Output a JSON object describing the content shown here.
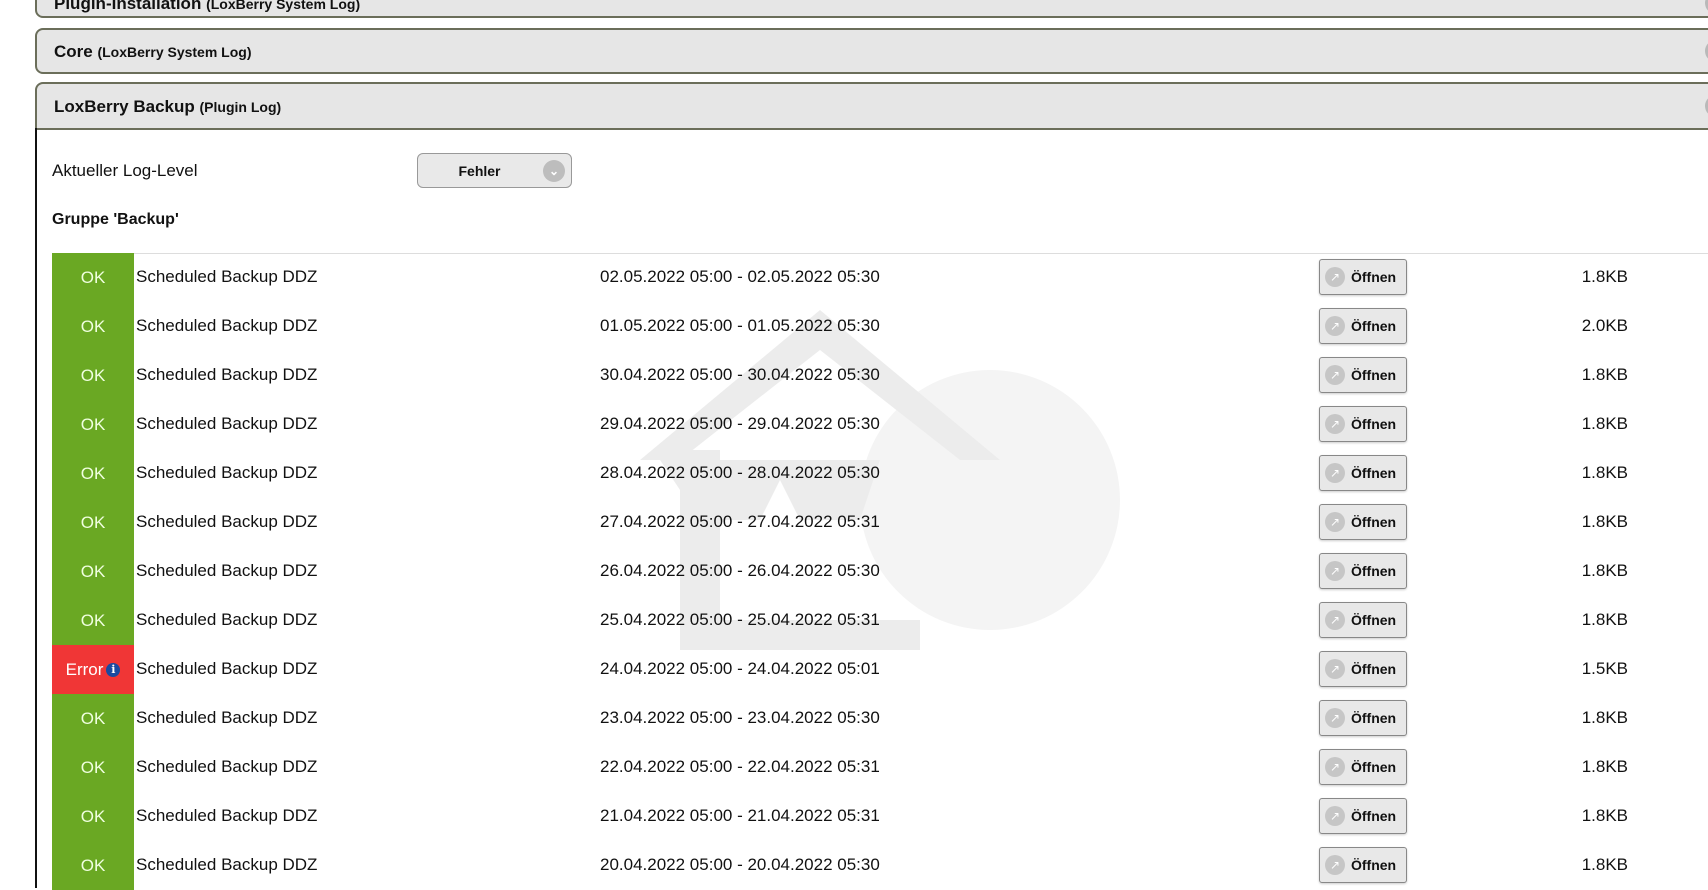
{
  "panels": [
    {
      "title": "Plugin-Installation",
      "subtitle": "(LoxBerry System Log)",
      "state": "collapsed"
    },
    {
      "title": "Core",
      "subtitle": "(LoxBerry System Log)",
      "state": "collapsed"
    },
    {
      "title": "LoxBerry Backup",
      "subtitle": "(Plugin Log)",
      "state": "expanded"
    }
  ],
  "loglevel": {
    "label": "Aktueller Log-Level",
    "value": "Fehler"
  },
  "group_title": "Gruppe 'Backup'",
  "open_label": "Öffnen",
  "rows": [
    {
      "status": "OK",
      "name": "Scheduled Backup DDZ",
      "time": "02.05.2022 05:00 - 02.05.2022 05:30",
      "size": "1.8KB"
    },
    {
      "status": "OK",
      "name": "Scheduled Backup DDZ",
      "time": "01.05.2022 05:00 - 01.05.2022 05:30",
      "size": "2.0KB"
    },
    {
      "status": "OK",
      "name": "Scheduled Backup DDZ",
      "time": "30.04.2022 05:00 - 30.04.2022 05:30",
      "size": "1.8KB"
    },
    {
      "status": "OK",
      "name": "Scheduled Backup DDZ",
      "time": "29.04.2022 05:00 - 29.04.2022 05:30",
      "size": "1.8KB"
    },
    {
      "status": "OK",
      "name": "Scheduled Backup DDZ",
      "time": "28.04.2022 05:00 - 28.04.2022 05:30",
      "size": "1.8KB"
    },
    {
      "status": "OK",
      "name": "Scheduled Backup DDZ",
      "time": "27.04.2022 05:00 - 27.04.2022 05:31",
      "size": "1.8KB"
    },
    {
      "status": "OK",
      "name": "Scheduled Backup DDZ",
      "time": "26.04.2022 05:00 - 26.04.2022 05:30",
      "size": "1.8KB"
    },
    {
      "status": "OK",
      "name": "Scheduled Backup DDZ",
      "time": "25.04.2022 05:00 - 25.04.2022 05:31",
      "size": "1.8KB"
    },
    {
      "status": "Error",
      "name": "Scheduled Backup DDZ",
      "time": "24.04.2022 05:00 - 24.04.2022 05:01",
      "size": "1.5KB"
    },
    {
      "status": "OK",
      "name": "Scheduled Backup DDZ",
      "time": "23.04.2022 05:00 - 23.04.2022 05:30",
      "size": "1.8KB"
    },
    {
      "status": "OK",
      "name": "Scheduled Backup DDZ",
      "time": "22.04.2022 05:00 - 22.04.2022 05:31",
      "size": "1.8KB"
    },
    {
      "status": "OK",
      "name": "Scheduled Backup DDZ",
      "time": "21.04.2022 05:00 - 21.04.2022 05:31",
      "size": "1.8KB"
    },
    {
      "status": "OK",
      "name": "Scheduled Backup DDZ",
      "time": "20.04.2022 05:00 - 20.04.2022 05:30",
      "size": "1.8KB"
    }
  ]
}
